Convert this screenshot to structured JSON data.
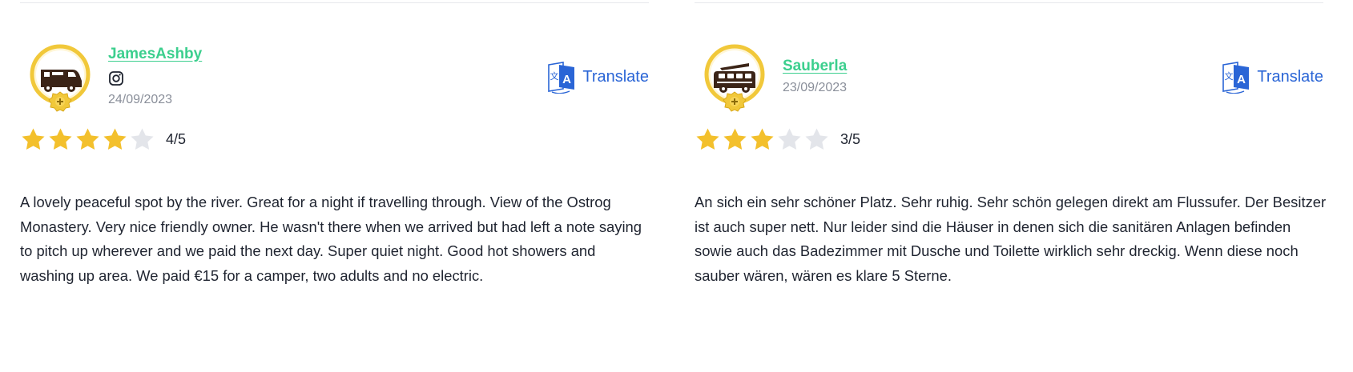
{
  "reviews": [
    {
      "username": "JamesAshby",
      "date": "24/09/2023",
      "has_instagram": true,
      "avatar_icon": "van-badge-icon",
      "rating": 4,
      "rating_max": 5,
      "rating_label": "4/5",
      "translate_label": "Translate",
      "text": "A lovely peaceful spot by the river. Great for a night if travelling through. View of the Ostrog Monastery. Very nice friendly owner. He wasn't there when we arrived but had left a note saying to pitch up wherever and we paid the next day. Super quiet night. Good hot showers and washing up area. We paid €15 for a camper, two adults and no electric."
    },
    {
      "username": "Sauberla",
      "date": "23/09/2023",
      "has_instagram": false,
      "avatar_icon": "pop-top-camper-badge-icon",
      "rating": 3,
      "rating_max": 5,
      "rating_label": "3/5",
      "translate_label": "Translate",
      "text": "An sich ein sehr schöner Platz. Sehr ruhig. Sehr schön gelegen direkt am Flussufer. Der Besitzer ist auch super nett. Nur leider sind die Häuser in denen sich die sanitären Anlagen befinden sowie auch das Badezimmer mit Dusche und Toilette wirklich sehr dreckig. Wenn diese noch sauber wären, wären es klare 5 Sterne."
    }
  ],
  "colors": {
    "username": "#3ccf8e",
    "translate": "#2a65d6",
    "star_filled": "#f3c02c",
    "star_empty": "#e3e5ea",
    "badge_ring": "#f1c83a",
    "avatar_dark": "#3b2417"
  }
}
